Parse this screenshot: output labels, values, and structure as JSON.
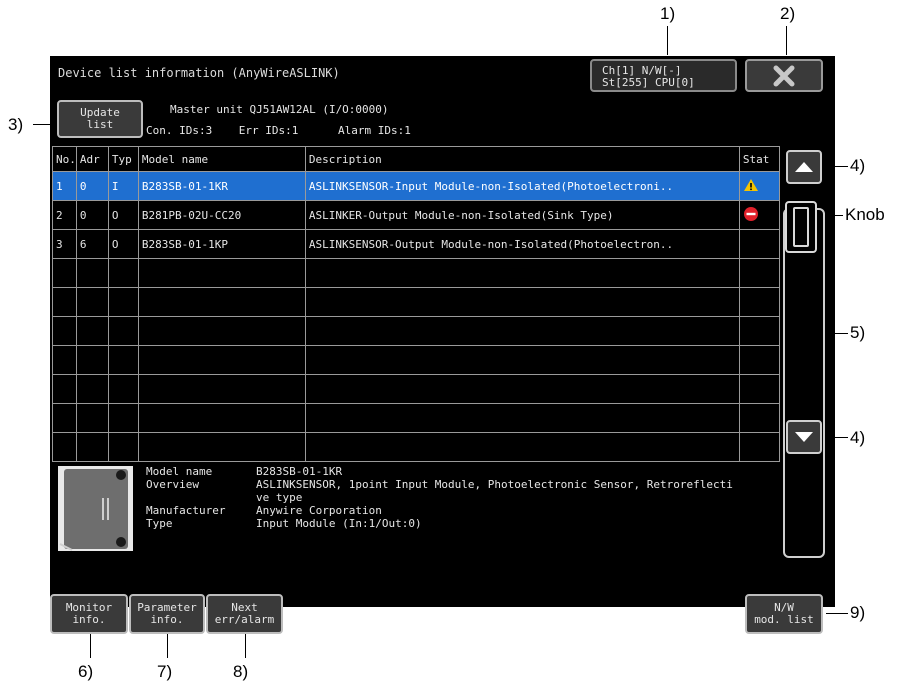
{
  "callouts": {
    "c1": "1)",
    "c2": "2)",
    "c3": "3)",
    "c4a": "4)",
    "c4b": "4)",
    "knob": "Knob",
    "c5": "5)",
    "c6": "6)",
    "c7": "7)",
    "c8": "8)",
    "c9": "9)"
  },
  "screen": {
    "title": "Device list information (AnyWireASLINK)",
    "channel": {
      "line1": "Ch[1]   N/W[-]",
      "line2": "St[255] CPU[0]"
    },
    "update_button": {
      "line1": "Update",
      "line2": "list"
    },
    "master_unit": "Master unit QJ51AW12AL (I/O:0000)",
    "counts": "Con. IDs:3    Err IDs:1      Alarm IDs:1"
  },
  "table": {
    "headers": [
      "No.",
      "Adr",
      "Typ",
      "Model name",
      "Description",
      "Stat"
    ],
    "rows": [
      {
        "no": "1",
        "adr": "0",
        "typ": "I",
        "model": "B283SB-01-1KR",
        "desc": "ASLINKSENSOR-Input Module-non-Isolated(Photoelectroni..",
        "stat": "warning"
      },
      {
        "no": "2",
        "adr": "0",
        "typ": "O",
        "model": "B281PB-02U-CC20",
        "desc": "ASLINKER-Output Module-non-Isolated(Sink Type)",
        "stat": "error"
      },
      {
        "no": "3",
        "adr": "6",
        "typ": "O",
        "model": "B283SB-01-1KP",
        "desc": "ASLINKSENSOR-Output Module-non-Isolated(Photoelectron..",
        "stat": ""
      }
    ]
  },
  "details": {
    "labels": [
      "Model name",
      "Overview",
      "",
      "Manufacturer",
      "Type"
    ],
    "values": [
      "B283SB-01-1KR",
      "ASLINKSENSOR, 1point Input Module, Photoelectronic Sensor, Retroreflecti",
      "ve type",
      "Anywire Corporation",
      "Input Module (In:1/Out:0)"
    ]
  },
  "buttons": {
    "monitor": {
      "line1": "Monitor",
      "line2": "info."
    },
    "parameter": {
      "line1": "Parameter",
      "line2": "info."
    },
    "next": {
      "line1": "Next",
      "line2": "err/alarm"
    },
    "nw": {
      "line1": "N/W",
      "line2": "mod. list"
    }
  },
  "colors": {
    "selected_row": "#1f6fd0",
    "warning": "#f5c400",
    "error": "#e0202a",
    "screen_bg": "#000000"
  }
}
